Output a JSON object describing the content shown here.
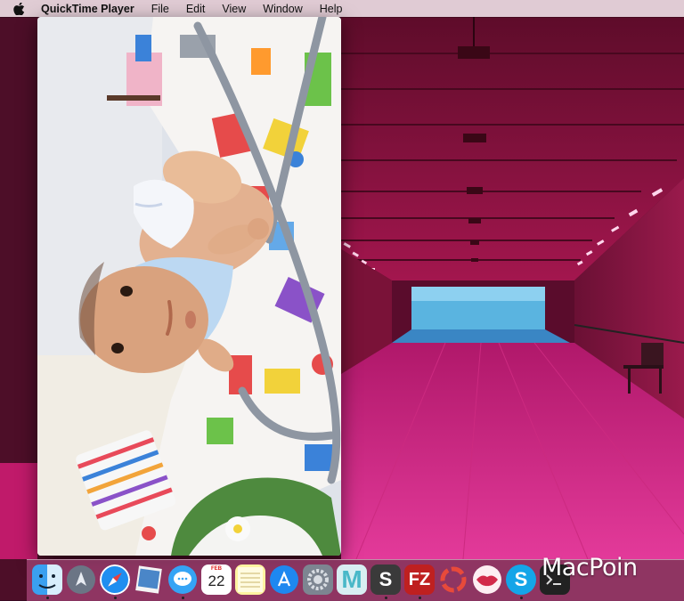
{
  "menubar": {
    "apple_icon": "apple-logo-icon",
    "app_name": "QuickTime Player",
    "menus": [
      "File",
      "Edit",
      "View",
      "Window",
      "Help"
    ]
  },
  "video_window": {
    "content": "video-frame-baby-on-blanket"
  },
  "calendar": {
    "month": "FEB",
    "day": "22"
  },
  "dock": {
    "items": [
      {
        "name": "finder",
        "icon": "finder-icon",
        "color": "#3aa0f0",
        "running": true
      },
      {
        "name": "launchpad",
        "icon": "rocket-icon",
        "color": "#6b7585",
        "running": false
      },
      {
        "name": "safari",
        "icon": "compass-icon",
        "color": "#1f8ef0",
        "running": true
      },
      {
        "name": "preview",
        "icon": "photo-stack-icon",
        "color": "#4a86c8",
        "running": false
      },
      {
        "name": "messages",
        "icon": "speech-bubble-icon",
        "color": "#35a4f5",
        "running": true
      },
      {
        "name": "calendar",
        "icon": "calendar-icon",
        "color": "#ffffff",
        "running": false
      },
      {
        "name": "notes",
        "icon": "notepad-icon",
        "color": "#fff3a0",
        "running": false
      },
      {
        "name": "app-store",
        "icon": "app-store-icon",
        "color": "#1e88f0",
        "running": false
      },
      {
        "name": "system-preferences",
        "icon": "gear-icon",
        "color": "#7d8591",
        "running": false
      },
      {
        "name": "mail-m",
        "icon": "letter-m-icon",
        "color": "#4ab8c8",
        "running": false
      },
      {
        "name": "sublime",
        "icon": "letter-s-icon",
        "color": "#3a3a3a",
        "running": true
      },
      {
        "name": "filezilla",
        "icon": "filezilla-icon",
        "color": "#bf2020",
        "running": true
      },
      {
        "name": "ring-app",
        "icon": "ring-icon",
        "color": "#e84a3a",
        "running": false
      },
      {
        "name": "lips-app",
        "icon": "lips-icon",
        "color": "#d22a4a",
        "running": false
      },
      {
        "name": "skype",
        "icon": "skype-icon",
        "color": "#14a5e8",
        "running": true
      },
      {
        "name": "terminal",
        "icon": "terminal-icon",
        "color": "#222222",
        "running": false
      }
    ]
  },
  "watermark": {
    "text": "MacPoin"
  },
  "colors": {
    "wallpaper_accent": "#d0156a",
    "menubar_bg": "#ecdae2"
  }
}
